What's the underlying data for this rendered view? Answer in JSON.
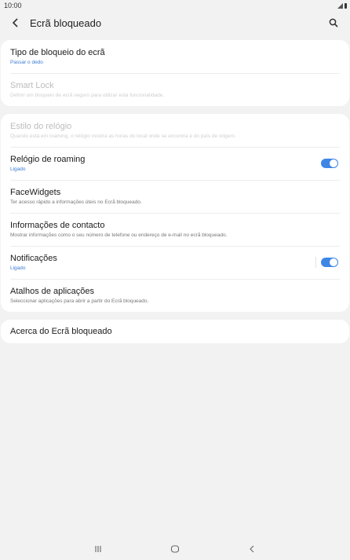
{
  "status": {
    "time": "10:00"
  },
  "header": {
    "title": "Ecrã bloqueado"
  },
  "sections": [
    {
      "items": [
        {
          "title": "Tipo de bloqueio do ecrã",
          "subtitle": "Passar o dedo"
        },
        {
          "title": "Smart Lock",
          "subtitle": "Definir um bloqueio de ecrã seguro para utilizar esta funcionalidade."
        }
      ]
    },
    {
      "items": [
        {
          "title": "Estilo do relógio",
          "subtitle": "Quando está em roaming, o relógio mostra as horas do local onde se encontra e do país de origem."
        },
        {
          "title": "Relógio de roaming",
          "subtitle": "Ligado",
          "toggle": true
        },
        {
          "title": "FaceWidgets",
          "subtitle": "Ter acesso rápido a informações úteis no Ecrã bloqueado."
        },
        {
          "title": "Informações de contacto",
          "subtitle": "Mostrar informações como o seu número de telefone ou endereço de e-mail no ecrã bloqueado."
        },
        {
          "title": "Notificações",
          "subtitle": "Ligado",
          "toggle": true
        },
        {
          "title": "Atalhos de aplicações",
          "subtitle": "Seleccionar aplicações para abrir a partir do Ecrã bloqueado."
        }
      ]
    },
    {
      "items": [
        {
          "title": "Acerca do Ecrã bloqueado"
        }
      ]
    }
  ],
  "colors": {
    "accent": "#3e86e6",
    "background": "#f2f2f2",
    "card": "#ffffff"
  },
  "icons": {
    "back": "chevron-left-icon",
    "search": "search-icon"
  }
}
